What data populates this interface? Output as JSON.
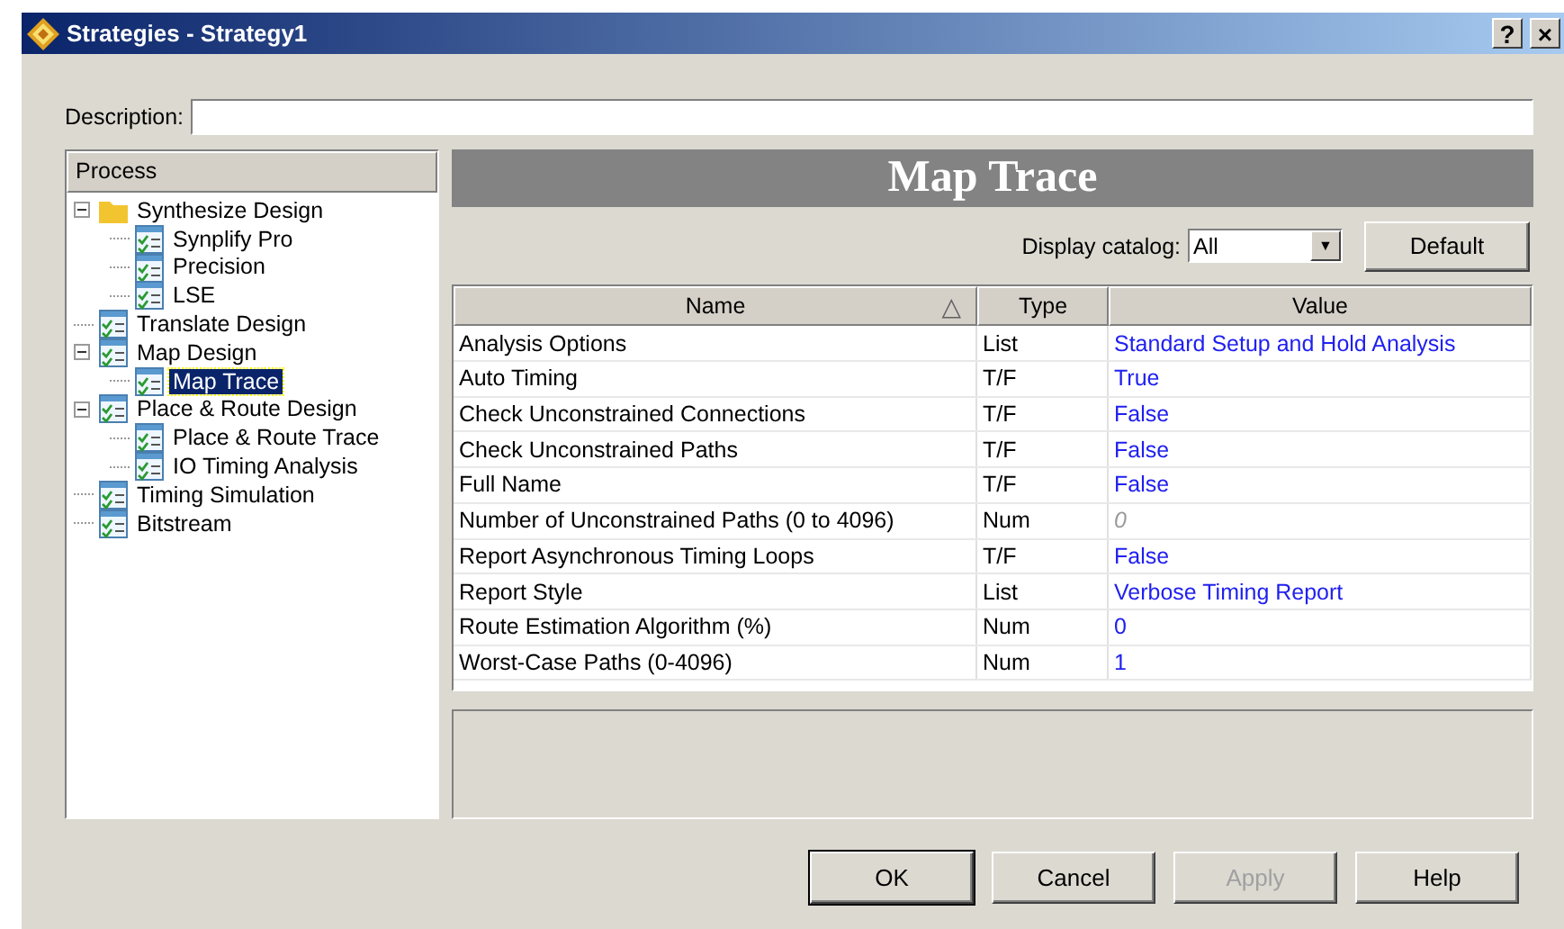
{
  "window": {
    "title": "Strategies - Strategy1",
    "help_button": "?",
    "close_button": "×"
  },
  "description": {
    "label": "Description:"
  },
  "process": {
    "header": "Process",
    "items": [
      {
        "label": "Synthesize Design",
        "kind": "folder",
        "expanded": true,
        "selected": false,
        "children": [
          {
            "label": "Synplify Pro",
            "kind": "strategy",
            "selected": false
          },
          {
            "label": "Precision",
            "kind": "strategy",
            "selected": false
          },
          {
            "label": "LSE",
            "kind": "strategy",
            "selected": false
          }
        ]
      },
      {
        "label": "Translate Design",
        "kind": "strategy",
        "selected": false
      },
      {
        "label": "Map Design",
        "kind": "strategy",
        "expanded": true,
        "selected": false,
        "children": [
          {
            "label": "Map Trace",
            "kind": "strategy",
            "selected": true
          }
        ]
      },
      {
        "label": "Place & Route Design",
        "kind": "strategy",
        "expanded": true,
        "selected": false,
        "children": [
          {
            "label": "Place & Route Trace",
            "kind": "strategy",
            "selected": false
          },
          {
            "label": "IO Timing Analysis",
            "kind": "strategy",
            "selected": false
          }
        ]
      },
      {
        "label": "Timing Simulation",
        "kind": "strategy",
        "selected": false
      },
      {
        "label": "Bitstream",
        "kind": "strategy",
        "selected": false
      }
    ]
  },
  "panel_title": "Map Trace",
  "catalog": {
    "label": "Display catalog:",
    "value": "All",
    "caret": "▼"
  },
  "default_button": "Default",
  "table": {
    "columns": [
      {
        "label": "Name",
        "sort_mark": "△"
      },
      {
        "label": "Type"
      },
      {
        "label": "Value"
      }
    ],
    "rows": [
      {
        "name": "Analysis Options",
        "type": "List",
        "value": "Standard Setup and Hold Analysis",
        "disabled": false
      },
      {
        "name": "Auto Timing",
        "type": "T/F",
        "value": "True",
        "disabled": false
      },
      {
        "name": "Check Unconstrained Connections",
        "type": "T/F",
        "value": "False",
        "disabled": false
      },
      {
        "name": "Check Unconstrained Paths",
        "type": "T/F",
        "value": "False",
        "disabled": false
      },
      {
        "name": "Full Name",
        "type": "T/F",
        "value": "False",
        "disabled": false
      },
      {
        "name": "Number of Unconstrained Paths (0 to 4096)",
        "type": "Num",
        "value": "0",
        "disabled": true
      },
      {
        "name": "Report Asynchronous Timing Loops",
        "type": "T/F",
        "value": "False",
        "disabled": false
      },
      {
        "name": "Report Style",
        "type": "List",
        "value": "Verbose Timing Report",
        "disabled": false
      },
      {
        "name": "Route Estimation Algorithm (%)",
        "type": "Num",
        "value": "0",
        "disabled": false
      },
      {
        "name": "Worst-Case Paths (0-4096)",
        "type": "Num",
        "value": "1",
        "disabled": false
      }
    ]
  },
  "buttons": [
    {
      "label": "OK",
      "default": true,
      "disabled": false
    },
    {
      "label": "Cancel",
      "default": false,
      "disabled": false
    },
    {
      "label": "Apply",
      "default": false,
      "disabled": true
    },
    {
      "label": "Help",
      "default": false,
      "disabled": false
    }
  ]
}
